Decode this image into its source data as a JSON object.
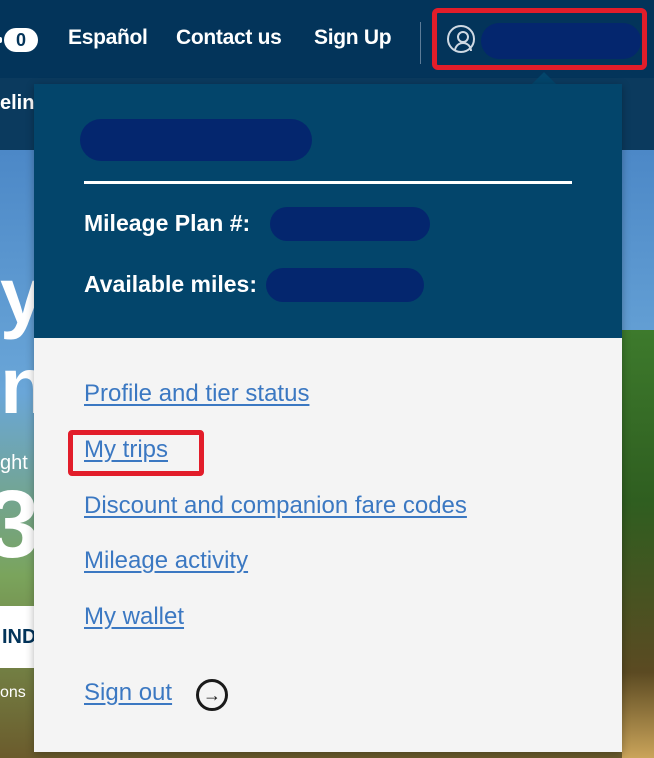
{
  "topnav": {
    "cart_count": "0",
    "espanol": "Español",
    "contact": "Contact us",
    "signup": "Sign Up"
  },
  "subnav_fragment": "eling",
  "hero": {
    "frag_y": "y",
    "frag_n": "n",
    "frag_ght": "ght",
    "frag_3": "3",
    "find_frag": "IND",
    "frag_ons": "ons"
  },
  "dropdown": {
    "mileage_plan_label": "Mileage Plan #:",
    "available_miles_label": "Available miles:",
    "links": {
      "profile": "Profile and tier status",
      "my_trips": "My trips",
      "discount": "Discount and companion fare codes",
      "mileage_activity": "Mileage activity",
      "wallet": "My wallet",
      "sign_out": "Sign out"
    }
  },
  "colors": {
    "nav_bg": "#03345a",
    "panel_header": "#03456b",
    "link": "#3b78c2",
    "highlight": "#e21d2a",
    "redaction": "#04266e"
  }
}
